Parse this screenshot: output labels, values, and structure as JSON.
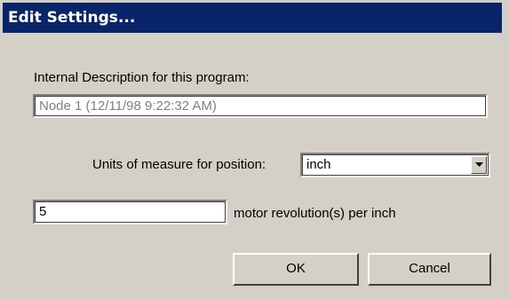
{
  "dialog": {
    "title": "Edit Settings...",
    "description_label": "Internal Description for this program:",
    "description_value": "Node 1 (12/11/98 9:22:32 AM)",
    "units_label": "Units of measure for position:",
    "units_value": "inch",
    "revolutions_value": "5",
    "revolutions_label": "motor revolution(s) per inch",
    "ok_label": "OK",
    "cancel_label": "Cancel"
  },
  "colors": {
    "titlebar": "#0a246a",
    "face": "#d4d0c8",
    "readonly_text": "#808080"
  },
  "icons": {
    "dropdown": "chevron-down-icon"
  }
}
